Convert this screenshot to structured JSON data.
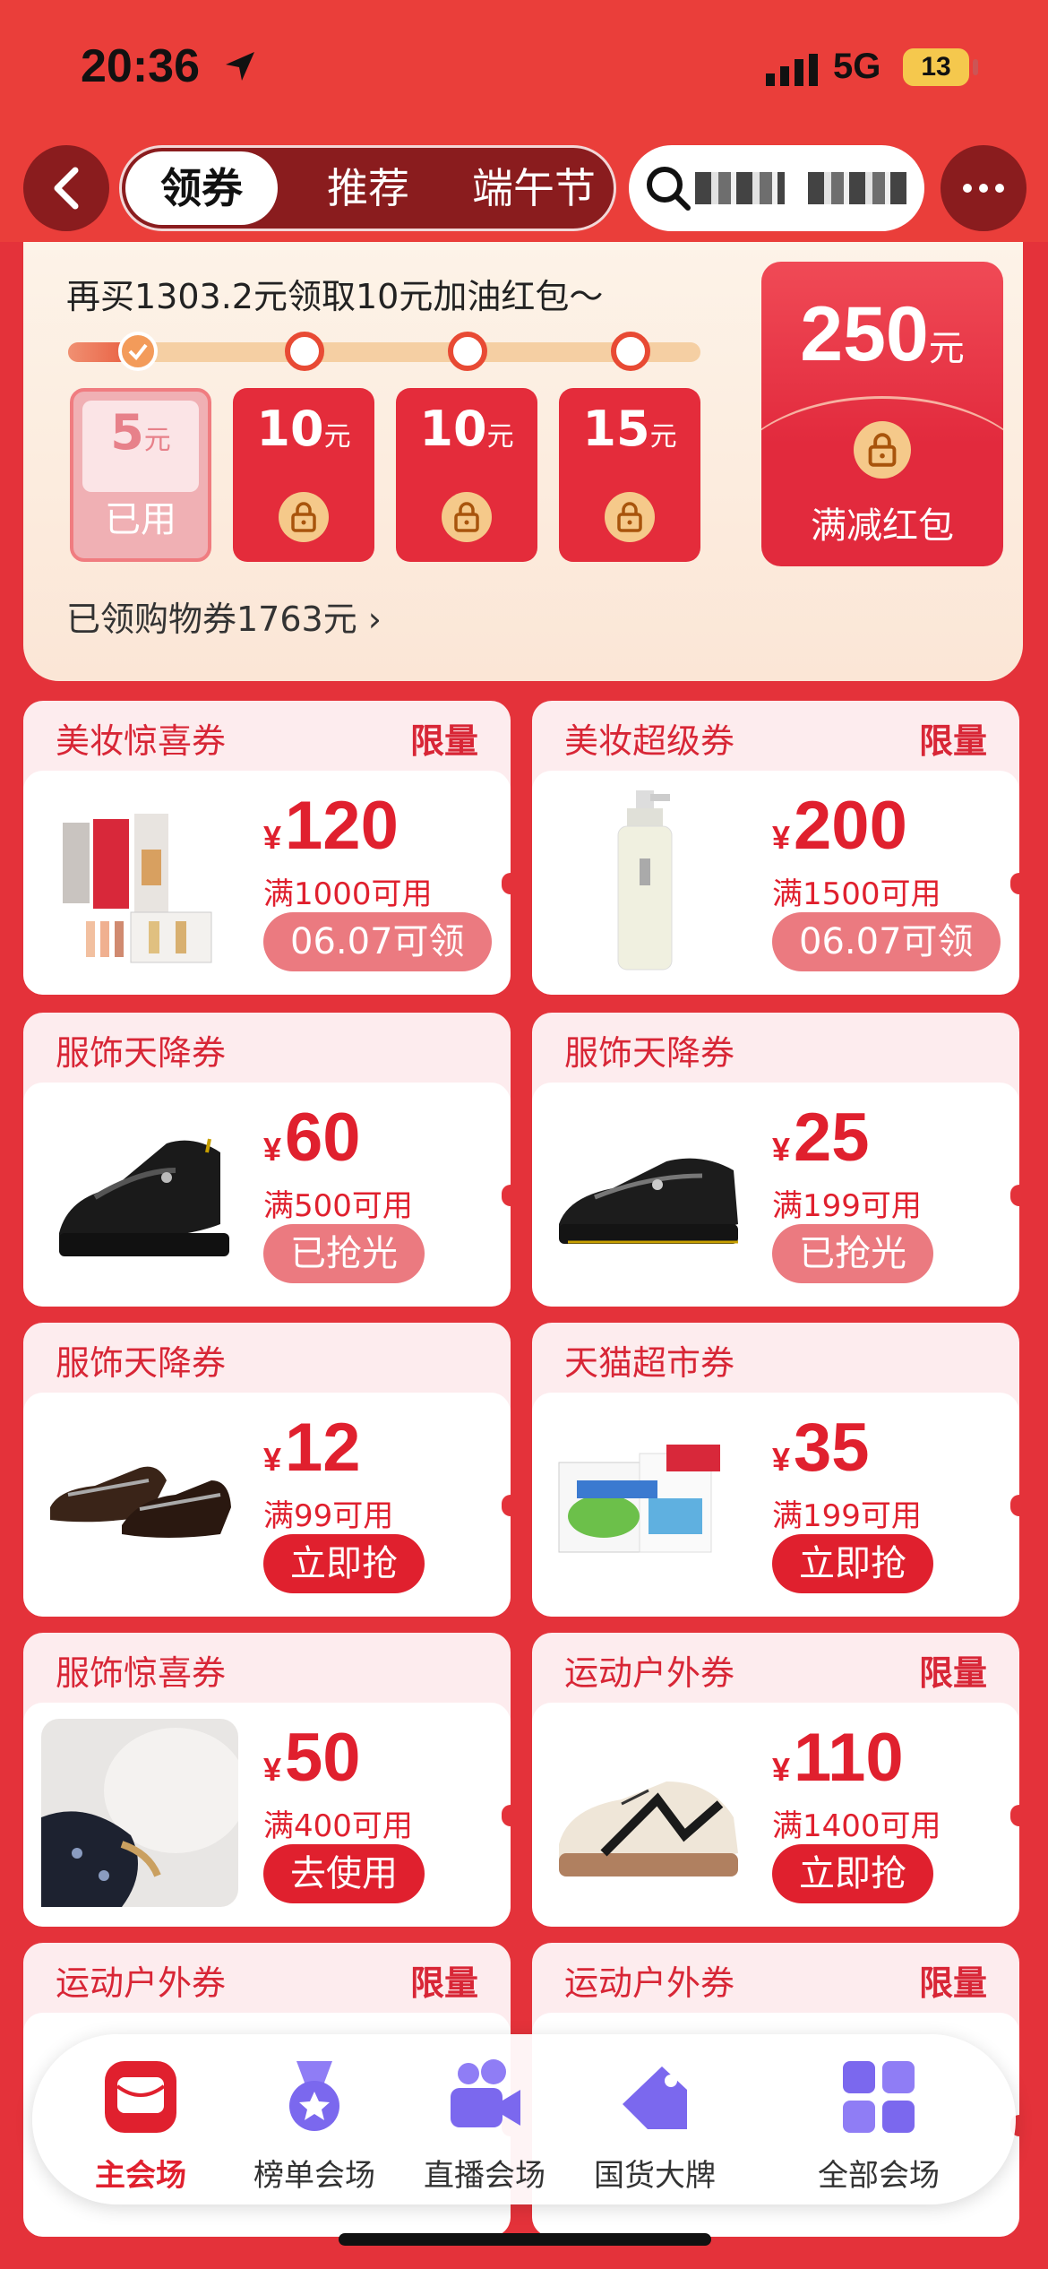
{
  "status_bar": {
    "time": "20:36",
    "network": "5G",
    "battery": "13"
  },
  "header": {
    "tabs": [
      {
        "label": "领券",
        "active": true
      },
      {
        "label": "推荐",
        "active": false
      },
      {
        "label": "端午节",
        "active": false
      }
    ]
  },
  "packet": {
    "title": "再买1303.2元领取10元加油红包～",
    "progress": 0.11,
    "tiles": [
      {
        "amount": "5",
        "unit": "元",
        "state": "已用"
      },
      {
        "amount": "10",
        "unit": "元",
        "state": "locked"
      },
      {
        "amount": "10",
        "unit": "元",
        "state": "locked"
      },
      {
        "amount": "15",
        "unit": "元",
        "state": "locked"
      }
    ],
    "big": {
      "amount": "250",
      "unit": "元",
      "label": "满减红包"
    },
    "claimed_text": "已领购物券1763元 ›"
  },
  "coupons": [
    {
      "title": "美妆惊喜券",
      "limit": "限量",
      "currency": "¥",
      "amount": "120",
      "condition": "满1000可用",
      "button": "06.07可领",
      "button_style": "pink",
      "image": "cosmetics-set"
    },
    {
      "title": "美妆超级券",
      "limit": "限量",
      "currency": "¥",
      "amount": "200",
      "condition": "满1500可用",
      "button": "06.07可领",
      "button_style": "pink",
      "image": "cleanser-bottle"
    },
    {
      "title": "服饰天降券",
      "limit": "",
      "currency": "¥",
      "amount": "60",
      "condition": "满500可用",
      "button": "已抢光",
      "button_style": "pink",
      "image": "black-platform-shoe"
    },
    {
      "title": "服饰天降券",
      "limit": "",
      "currency": "¥",
      "amount": "25",
      "condition": "满199可用",
      "button": "已抢光",
      "button_style": "pink",
      "image": "black-mary-jane-shoe"
    },
    {
      "title": "服饰天降券",
      "limit": "",
      "currency": "¥",
      "amount": "12",
      "condition": "满99可用",
      "button": "立即抢",
      "button_style": "red",
      "image": "brown-shoes"
    },
    {
      "title": "天猫超市券",
      "limit": "",
      "currency": "¥",
      "amount": "35",
      "condition": "满199可用",
      "button": "立即抢",
      "button_style": "red",
      "image": "milk-boxes"
    },
    {
      "title": "服饰惊喜券",
      "limit": "",
      "currency": "¥",
      "amount": "50",
      "condition": "满400可用",
      "button": "去使用",
      "button_style": "red",
      "image": "pillow-photo"
    },
    {
      "title": "运动户外券",
      "limit": "限量",
      "currency": "¥",
      "amount": "110",
      "condition": "满1400可用",
      "button": "立即抢",
      "button_style": "red",
      "image": "sneaker"
    },
    {
      "title": "运动户外券",
      "limit": "限量",
      "currency": "",
      "amount": "",
      "condition": "",
      "button": "",
      "button_style": "red",
      "image": ""
    },
    {
      "title": "运动户外券",
      "limit": "限量",
      "currency": "",
      "amount": "",
      "condition": "",
      "button": "",
      "button_style": "red",
      "image": ""
    }
  ],
  "tabbar": [
    {
      "label": "主会场",
      "icon": "main-venue-icon",
      "active": true
    },
    {
      "label": "榜单会场",
      "icon": "medal-icon",
      "active": false
    },
    {
      "label": "直播会场",
      "icon": "video-camera-icon",
      "active": false
    },
    {
      "label": "国货大牌",
      "icon": "price-tag-icon",
      "active": false
    },
    {
      "label": "全部会场",
      "icon": "grid-icon",
      "active": false
    }
  ]
}
